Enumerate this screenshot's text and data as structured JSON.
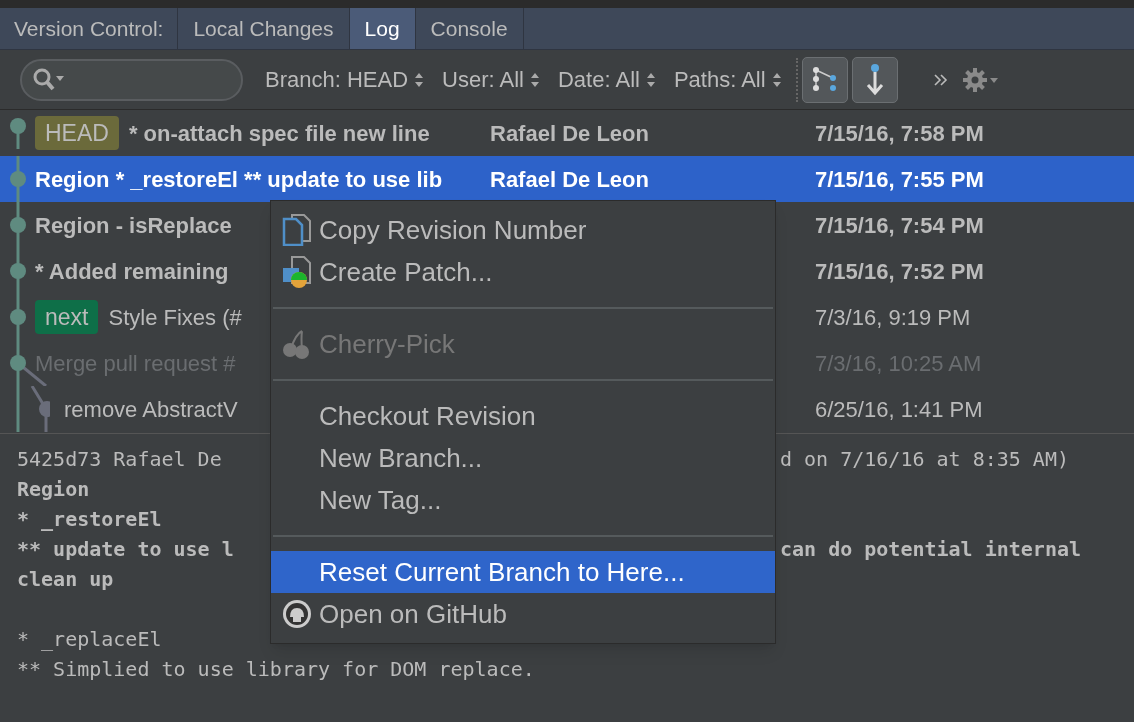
{
  "tab_bar": {
    "label": "Version Control:",
    "tabs": [
      {
        "label": "Local Changes",
        "selected": false
      },
      {
        "label": "Log",
        "selected": true
      },
      {
        "label": "Console",
        "selected": false
      }
    ]
  },
  "toolbar": {
    "filters": [
      {
        "label": "Branch: HEAD"
      },
      {
        "label": "User: All"
      },
      {
        "label": "Date: All"
      },
      {
        "label": "Paths: All"
      }
    ],
    "toggles": [
      {
        "kind": "graph",
        "on": true
      },
      {
        "kind": "arrow",
        "on": true
      }
    ]
  },
  "commits": [
    {
      "kind": "main",
      "tag": {
        "label": "HEAD",
        "color": "#6b6a3b"
      },
      "subject": "* on-attach spec file new line",
      "author": "Rafael De Leon",
      "date": "7/15/16, 7:58 PM",
      "bold": true,
      "dimmed": false,
      "selected": false
    },
    {
      "kind": "main",
      "subject": "Region * _restoreEl ** update to use lib",
      "author": "Rafael De Leon",
      "date": "7/15/16, 7:55 PM",
      "bold": true,
      "dimmed": false,
      "selected": true
    },
    {
      "kind": "main",
      "subject": "Region - isReplace",
      "date": "7/15/16, 7:54 PM",
      "bold": true,
      "dimmed": false,
      "selected": false
    },
    {
      "kind": "main",
      "subject": "* Added remaining",
      "date": "7/15/16, 7:52 PM",
      "bold": true,
      "dimmed": false,
      "selected": false
    },
    {
      "kind": "main",
      "tag": {
        "label": "next",
        "color": "#0e6f48"
      },
      "subject": "Style Fixes (#",
      "date": "7/3/16, 9:19 PM",
      "bold": false,
      "dimmed": false,
      "selected": false
    },
    {
      "kind": "merge",
      "subject": "Merge pull request #",
      "date": "7/3/16, 10:25 AM",
      "bold": false,
      "dimmed": true,
      "selected": false
    },
    {
      "kind": "side",
      "subject": "remove AbstractV",
      "date": "6/25/16, 1:41 PM",
      "bold": false,
      "dimmed": false,
      "selected": false
    }
  ],
  "details": [
    {
      "kind": "text",
      "left": "5425d73 Rafael De",
      "right": "d on 7/16/16 at 8:35 AM)",
      "bold": false
    },
    {
      "kind": "text",
      "left": "Region",
      "bold": true
    },
    {
      "kind": "text",
      "left": "* _restoreEl",
      "bold": true
    },
    {
      "kind": "text",
      "left": "** update to use l",
      "right": "can do potential internal",
      "bold": true
    },
    {
      "kind": "text",
      "left": "clean up",
      "bold": true
    },
    {
      "kind": "blank"
    },
    {
      "kind": "text",
      "left": "* _replaceEl",
      "bold": false
    },
    {
      "kind": "text",
      "left": "** Simplied to use library for DOM replace.",
      "bold": false
    }
  ],
  "context_menu": {
    "items": [
      {
        "kind": "copy",
        "label": "Copy Revision Number",
        "disabled": false,
        "selected": false
      },
      {
        "kind": "patch",
        "label": "Create Patch...",
        "disabled": false,
        "selected": false
      },
      {
        "kind": "separator"
      },
      {
        "kind": "cherry",
        "label": "Cherry-Pick",
        "disabled": true,
        "selected": false
      },
      {
        "kind": "separator"
      },
      {
        "kind": "plain",
        "label": "Checkout Revision",
        "disabled": false,
        "selected": false
      },
      {
        "kind": "plain",
        "label": "New Branch...",
        "disabled": false,
        "selected": false
      },
      {
        "kind": "plain",
        "label": "New Tag...",
        "disabled": false,
        "selected": false
      },
      {
        "kind": "separator"
      },
      {
        "kind": "plain",
        "label": "Reset Current Branch to Here...",
        "disabled": false,
        "selected": true
      },
      {
        "kind": "github",
        "label": "Open on GitHub",
        "disabled": false,
        "selected": false
      }
    ]
  }
}
